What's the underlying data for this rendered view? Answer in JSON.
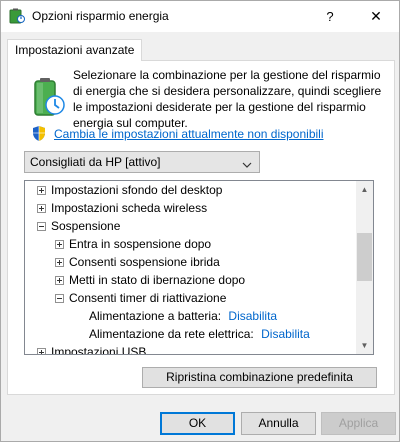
{
  "window": {
    "title": "Opzioni risparmio energia",
    "help_glyph": "?",
    "close_glyph": "✕"
  },
  "tab": {
    "label": "Impostazioni avanzate"
  },
  "intro": {
    "description": "Selezionare la combinazione per la gestione del risparmio di energia che si desidera personalizzare, quindi scegliere le impostazioni desiderate per la gestione del risparmio energia sul computer.",
    "link_text": "Cambia le impostazioni attualmente non disponibili"
  },
  "plan_select": {
    "selected": "Consigliati da HP [attivo]"
  },
  "tree": {
    "items": [
      {
        "label": "Impostazioni sfondo del desktop"
      },
      {
        "label": "Impostazioni scheda wireless"
      },
      {
        "label": "Sospensione"
      },
      {
        "label": "Entra in sospensione dopo"
      },
      {
        "label": "Consenti sospensione ibrida"
      },
      {
        "label": "Metti in stato di ibernazione dopo"
      },
      {
        "label": "Consenti timer di riattivazione"
      },
      {
        "label": "Alimentazione a batteria:",
        "value": "Disabilita"
      },
      {
        "label": "Alimentazione da rete elettrica:",
        "value": "Disabilita"
      },
      {
        "label": "Impostazioni USB"
      }
    ]
  },
  "buttons": {
    "restore": "Ripristina combinazione predefinita",
    "ok": "OK",
    "cancel": "Annulla",
    "apply": "Applica"
  },
  "colors": {
    "link": "#0066cc",
    "accent": "#0078d7"
  }
}
